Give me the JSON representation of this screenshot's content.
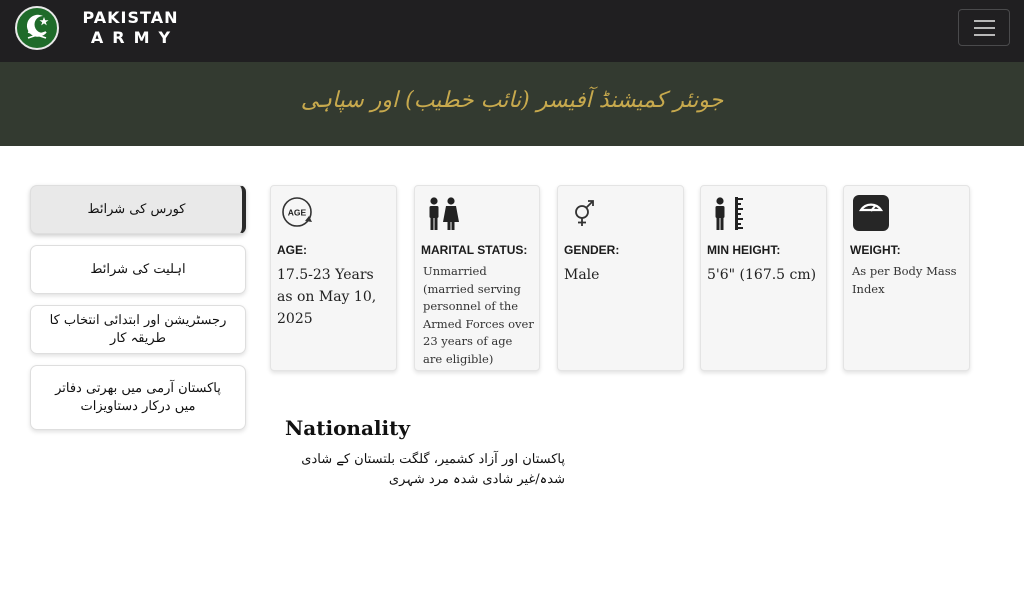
{
  "header": {
    "brand_line1": "PAKISTAN",
    "brand_line2": "ARMY",
    "logo_icon": "crescent-star-swords-emblem",
    "menu_icon": "hamburger-menu-icon"
  },
  "banner": {
    "title": "جونئر کمیشنڈ آفیسر (نائب خطیب) اور سپاہی"
  },
  "sidebar": {
    "items": [
      {
        "label": "کورس کی شرائط",
        "active": true
      },
      {
        "label": "اہلیت کی شرائط",
        "active": false
      },
      {
        "label": "رجسٹریشن اور ابتدائی انتخاب کا طریقہ کار",
        "active": false
      },
      {
        "label": "پاکستان آرمی میں بھرتی دفاتر میں درکار دستاویزات",
        "active": false
      }
    ]
  },
  "cards": [
    {
      "icon": "age-icon",
      "label": "AGE:",
      "value": "17.5-23 Years as on May 10, 2025"
    },
    {
      "icon": "couple-icon",
      "label": "MARITAL STATUS:",
      "value": "Unmarried (married serving personnel of the Armed Forces over 23 years of age are eligible)"
    },
    {
      "icon": "gender-icon",
      "label": "GENDER:",
      "value": "Male"
    },
    {
      "icon": "height-icon",
      "label": "MIN HEIGHT:",
      "value": "5'6\" (167.5 cm)"
    },
    {
      "icon": "weight-scale-icon",
      "label": "WEIGHT:",
      "value": "As per Body Mass Index"
    }
  ],
  "nationality": {
    "title": "Nationality",
    "text": "پاکستان اور آزاد کشمیر، گلگت بلتستان کے شادی شدہ/غیر شادی شدہ مرد شہری"
  },
  "colors": {
    "navbar": "#201f21",
    "banner": "#333a30",
    "banner_text": "#c7a94d",
    "logo_green": "#1f6b2a"
  }
}
